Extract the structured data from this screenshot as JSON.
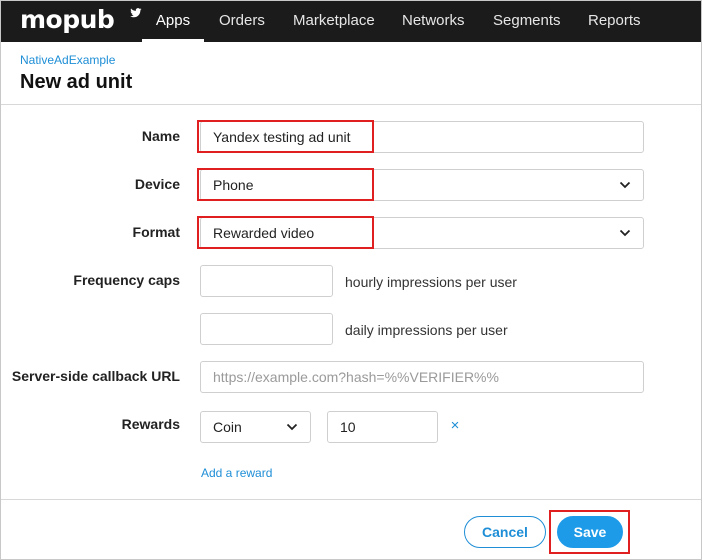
{
  "brand": {
    "name": "mopub"
  },
  "nav": {
    "items": [
      {
        "label": "Apps",
        "active": true
      },
      {
        "label": "Orders",
        "active": false
      },
      {
        "label": "Marketplace",
        "active": false
      },
      {
        "label": "Networks",
        "active": false
      },
      {
        "label": "Segments",
        "active": false
      },
      {
        "label": "Reports",
        "active": false
      }
    ]
  },
  "header": {
    "breadcrumb": "NativeAdExample",
    "title": "New ad unit"
  },
  "form": {
    "name": {
      "label": "Name",
      "value": "Yandex testing ad unit"
    },
    "device": {
      "label": "Device",
      "value": "Phone"
    },
    "format": {
      "label": "Format",
      "value": "Rewarded video"
    },
    "frequency_caps": {
      "label": "Frequency caps",
      "hourly_value": "",
      "hourly_helper": "hourly impressions per user",
      "daily_value": "",
      "daily_helper": "daily impressions per user"
    },
    "callback": {
      "label": "Server-side callback URL",
      "value": "",
      "placeholder": "https://example.com?hash=%%VERIFIER%%"
    },
    "rewards": {
      "label": "Rewards",
      "currency": "Coin",
      "amount": "10",
      "remove_glyph": "×",
      "add_label": "Add a reward"
    }
  },
  "actions": {
    "cancel_label": "Cancel",
    "save_label": "Save"
  },
  "colors": {
    "accent": "#1e9be8",
    "link": "#1e8ed6",
    "nav_bg": "#1b1b1b",
    "highlight": "#e02020"
  }
}
